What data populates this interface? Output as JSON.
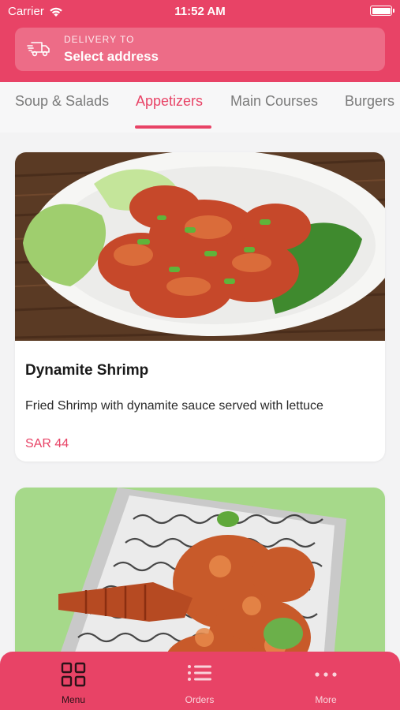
{
  "status": {
    "carrier": "Carrier",
    "time": "11:52 AM"
  },
  "delivery": {
    "label": "DELIVERY TO",
    "value": "Select address"
  },
  "tabs": [
    {
      "label": "Soup & Salads",
      "active": false
    },
    {
      "label": "Appetizers",
      "active": true
    },
    {
      "label": "Main Courses",
      "active": false
    },
    {
      "label": "Burgers",
      "active": false
    }
  ],
  "items": [
    {
      "name": "Dynamite Shrimp",
      "description": "Fried Shrimp with dynamite sauce served with lettuce",
      "price": "SAR 44"
    }
  ],
  "nav": [
    {
      "label": "Menu",
      "icon": "grid-icon",
      "active": true
    },
    {
      "label": "Orders",
      "icon": "list-icon",
      "active": false
    },
    {
      "label": "More",
      "icon": "more-icon",
      "active": false
    }
  ],
  "colors": {
    "brand": "#e84366",
    "background": "#f3f3f4",
    "price": "#e84366"
  }
}
